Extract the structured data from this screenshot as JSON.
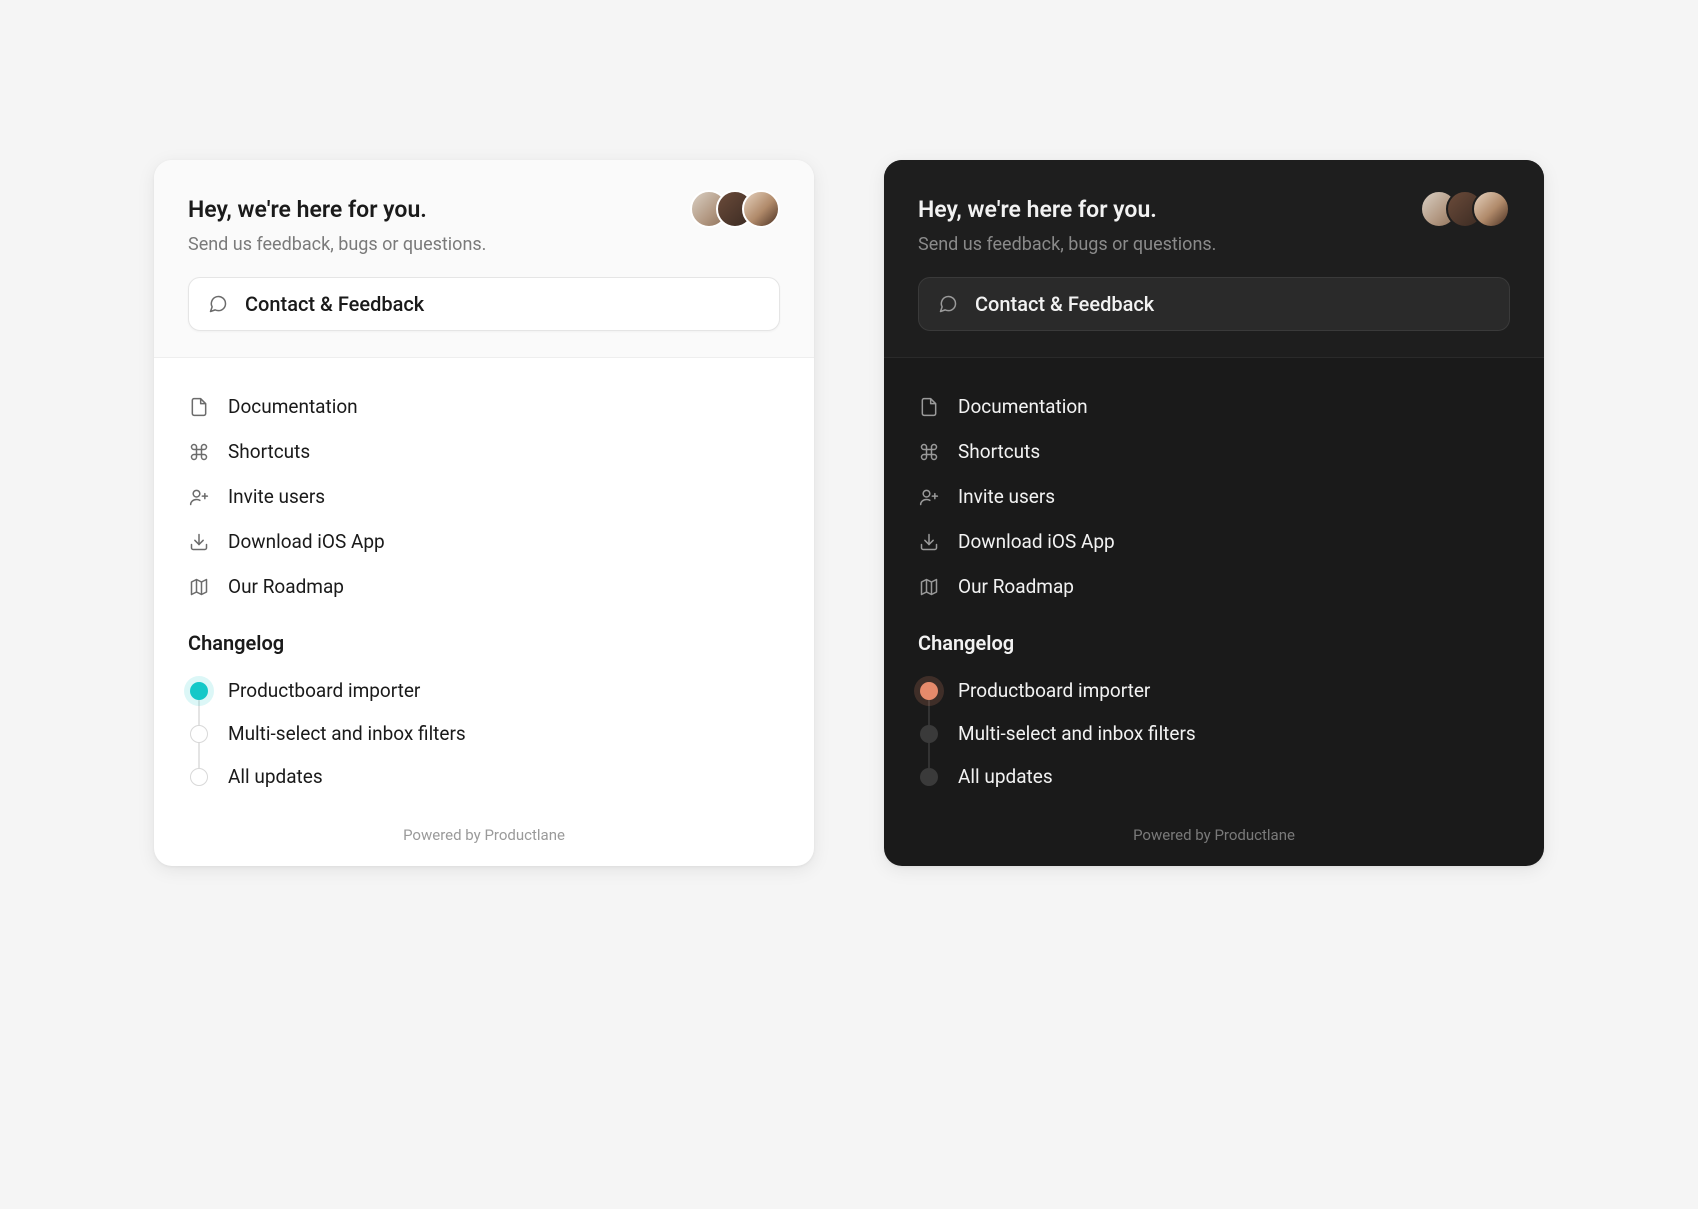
{
  "header": {
    "title": "Hey, we're here for you.",
    "subtitle": "Send us feedback, bugs or questions.",
    "contact_label": "Contact & Feedback"
  },
  "menu": {
    "items": [
      {
        "icon": "document-icon",
        "label": "Documentation"
      },
      {
        "icon": "command-icon",
        "label": "Shortcuts"
      },
      {
        "icon": "user-plus-icon",
        "label": "Invite users"
      },
      {
        "icon": "download-icon",
        "label": "Download iOS App"
      },
      {
        "icon": "map-icon",
        "label": "Our Roadmap"
      }
    ]
  },
  "changelog": {
    "title": "Changelog",
    "items": [
      {
        "label": "Productboard importer",
        "highlighted": true
      },
      {
        "label": "Multi-select and inbox filters",
        "highlighted": false
      },
      {
        "label": "All updates",
        "highlighted": false
      }
    ]
  },
  "footer": "Powered by Productlane",
  "colors": {
    "light_accent": "#14c8c8",
    "dark_accent": "#e78a6b"
  }
}
